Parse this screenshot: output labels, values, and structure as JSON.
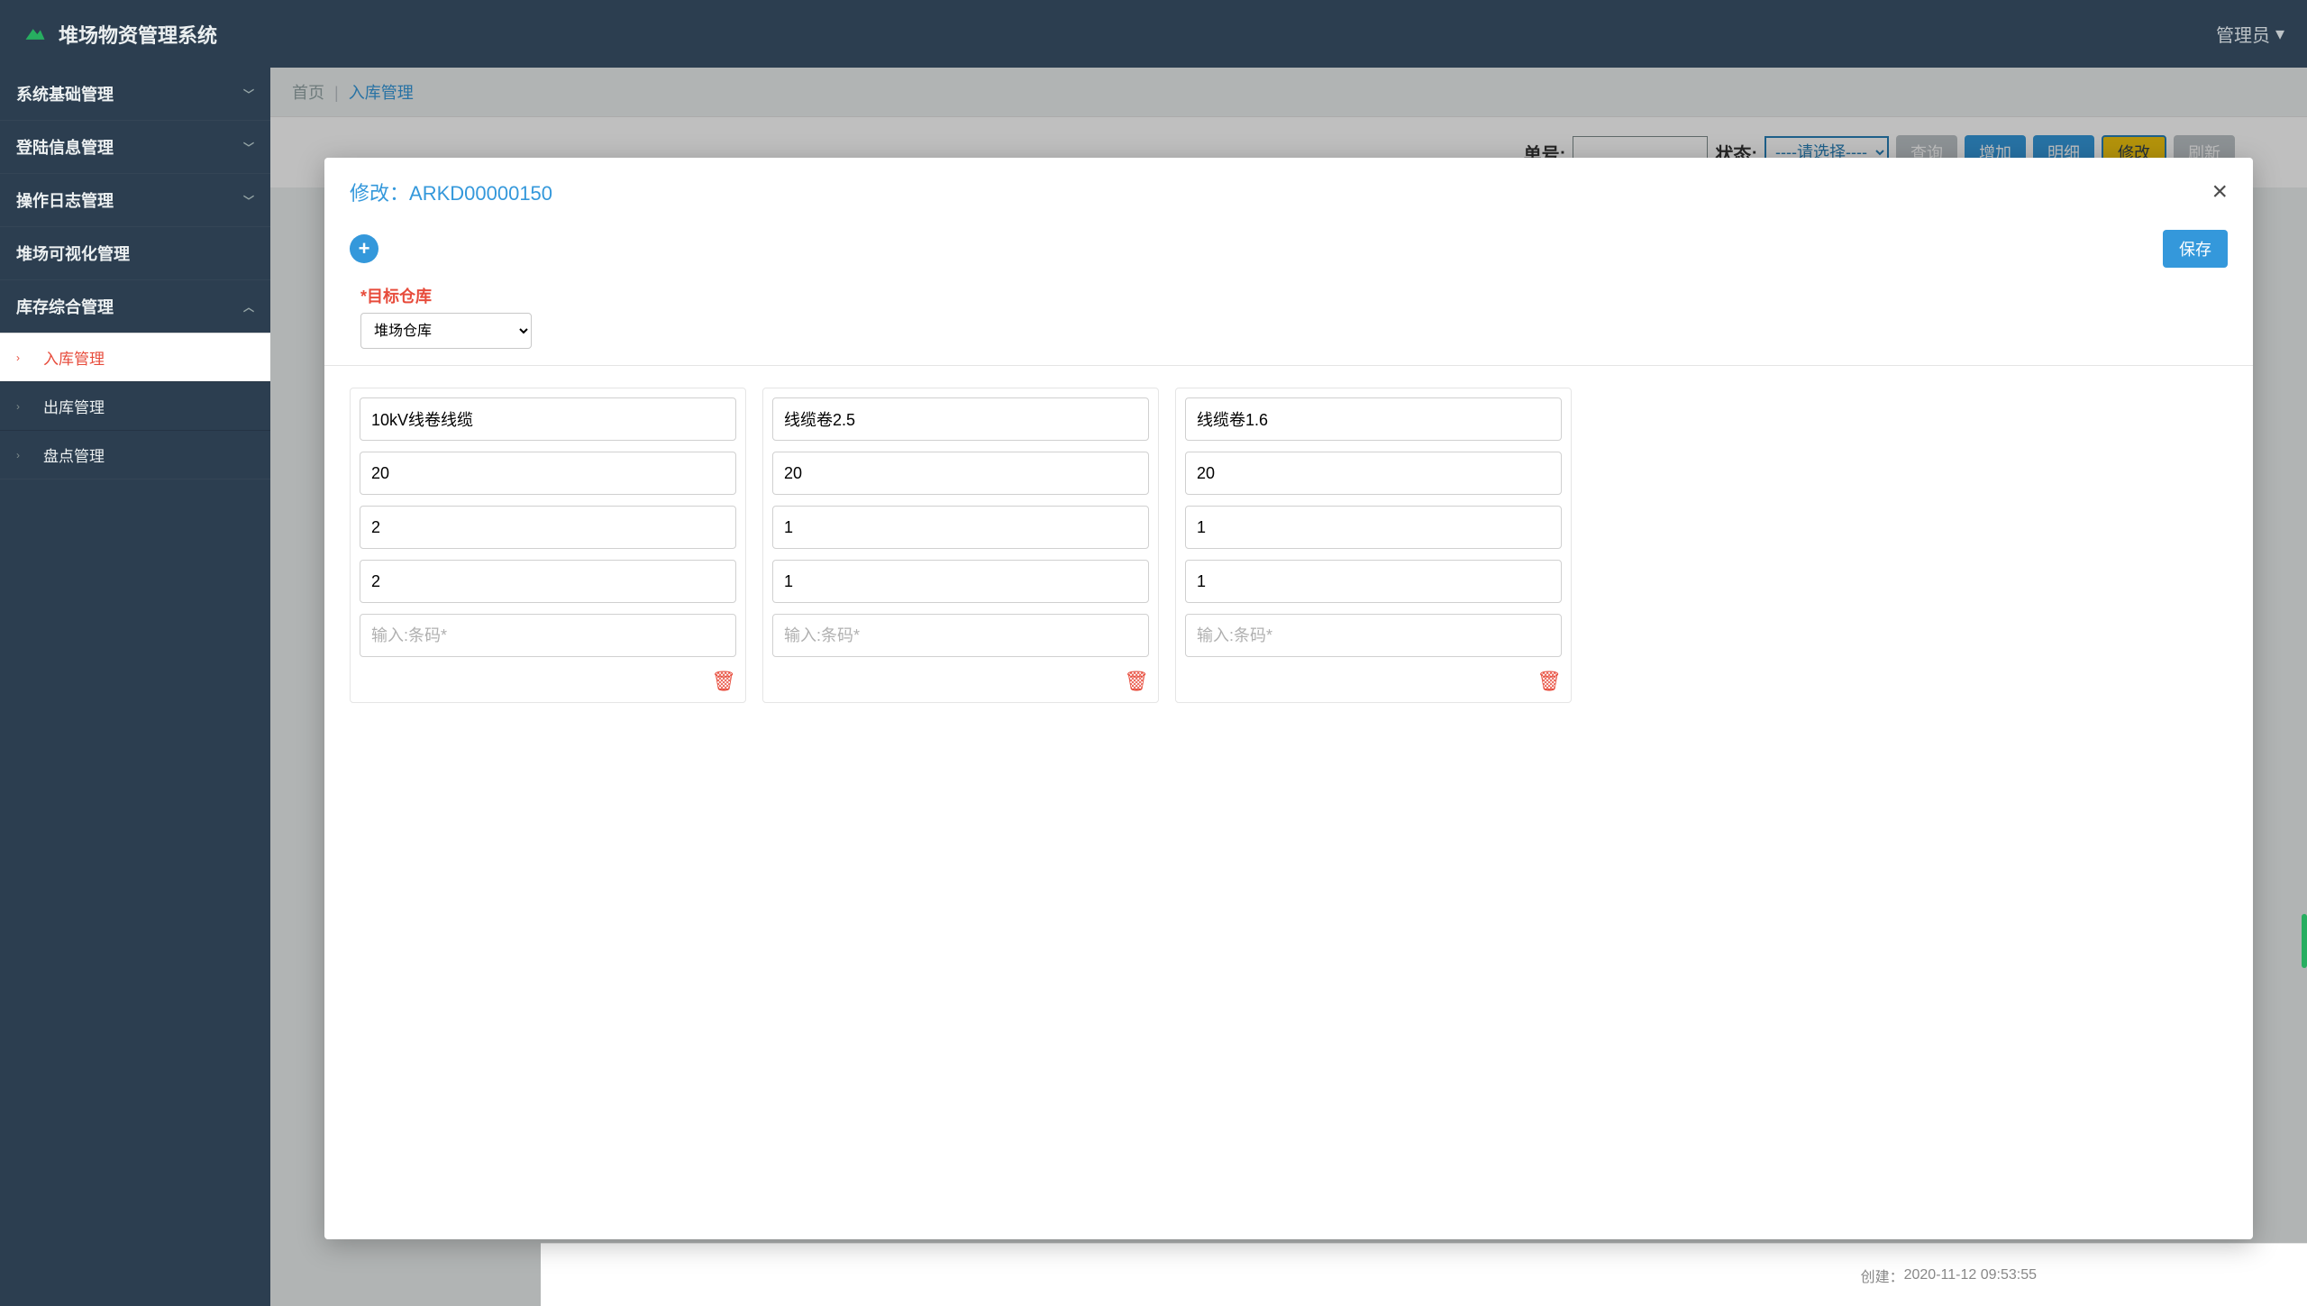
{
  "header": {
    "app_title": "堆场物资管理系统",
    "user_label": "管理员"
  },
  "sidebar": {
    "groups": [
      {
        "label": "系统基础管理",
        "expanded": false
      },
      {
        "label": "登陆信息管理",
        "expanded": false
      },
      {
        "label": "操作日志管理",
        "expanded": false
      },
      {
        "label": "堆场可视化管理",
        "expanded": false,
        "no_caret": true
      },
      {
        "label": "库存综合管理",
        "expanded": true
      }
    ],
    "inventory_submenu": [
      {
        "label": "入库管理",
        "active": true
      },
      {
        "label": "出库管理",
        "active": false
      },
      {
        "label": "盘点管理",
        "active": false
      }
    ]
  },
  "breadcrumb": {
    "home": "首页",
    "current": "入库管理"
  },
  "filterbar": {
    "order_label": "单号:",
    "status_label": "状态:",
    "status_placeholder": "----请选择----",
    "btn_query": "查询",
    "btn_add": "增加",
    "btn_detail": "明细",
    "btn_edit": "修改",
    "btn_refresh": "刷新"
  },
  "modal": {
    "title_prefix": "修改：",
    "record_id": "ARKD00000150",
    "save_label": "保存",
    "target_label": "*目标仓库",
    "target_value": "堆场仓库",
    "barcode_placeholder": "输入:条码*",
    "items": [
      {
        "name": "10kV线卷线缆",
        "qty": "20",
        "f3": "2",
        "f4": "2",
        "barcode": ""
      },
      {
        "name": "线缆卷2.5",
        "qty": "20",
        "f3": "1",
        "f4": "1",
        "barcode": ""
      },
      {
        "name": "线缆卷1.6",
        "qty": "20",
        "f3": "1",
        "f4": "1",
        "barcode": ""
      }
    ]
  },
  "bg_stub": {
    "created_label": "创建：",
    "created_value": "2020-11-12 09:53:55"
  }
}
